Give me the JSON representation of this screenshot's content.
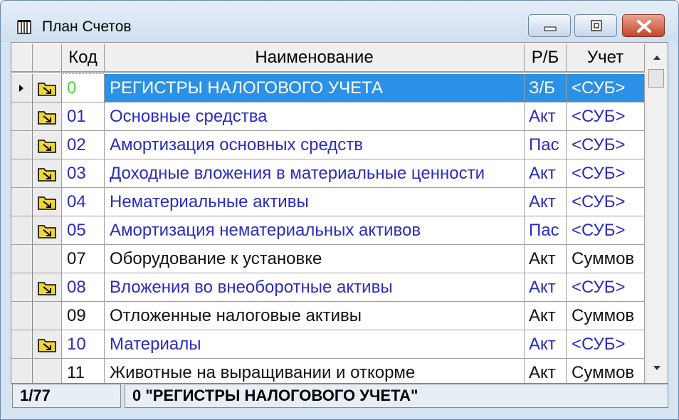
{
  "window": {
    "title": "План Счетов",
    "icon": "book-icon",
    "buttons": {
      "minimize": "minimize-icon",
      "maximize": "maximize-icon",
      "close": "close-icon"
    }
  },
  "grid": {
    "columns": [
      "Код",
      "Наименование",
      "Р/Б",
      "Учет"
    ],
    "rows": [
      {
        "folder": true,
        "code": "0",
        "name": "РЕГИСТРЫ НАЛОГОВОГО УЧЕТА",
        "rb": "З/Б",
        "uchet": "<СУБ>",
        "selected": true
      },
      {
        "folder": true,
        "code": "01",
        "name": "Основные средства",
        "rb": "Акт",
        "uchet": "<СУБ>"
      },
      {
        "folder": true,
        "code": "02",
        "name": "Амортизация основных средств",
        "rb": "Пас",
        "uchet": "<СУБ>"
      },
      {
        "folder": true,
        "code": "03",
        "name": "Доходные вложения в материальные ценности",
        "rb": "Акт",
        "uchet": "<СУБ>"
      },
      {
        "folder": true,
        "code": "04",
        "name": "Нематериальные активы",
        "rb": "Акт",
        "uchet": "<СУБ>"
      },
      {
        "folder": true,
        "code": "05",
        "name": "Амортизация нематериальных активов",
        "rb": "Пас",
        "uchet": "<СУБ>"
      },
      {
        "folder": false,
        "code": "07",
        "name": "Оборудование к установке",
        "rb": "Акт",
        "uchet": "Суммов"
      },
      {
        "folder": true,
        "code": "08",
        "name": "Вложения во внеоборотные активы",
        "rb": "Акт",
        "uchet": "<СУБ>"
      },
      {
        "folder": false,
        "code": "09",
        "name": "Отложенные налоговые активы",
        "rb": "Акт",
        "uchet": "Суммов"
      },
      {
        "folder": true,
        "code": "10",
        "name": "Материалы",
        "rb": "Акт",
        "uchet": "<СУБ>"
      },
      {
        "folder": false,
        "code": "11",
        "name": "Животные на выращивании и откорме",
        "rb": "Акт",
        "uchet": "Суммов"
      }
    ]
  },
  "status": {
    "position": "1/77",
    "current": "0 \"РЕГИСТРЫ НАЛОГОВОГО УЧЕТА\""
  },
  "colors": {
    "selection": "#2a91e6",
    "selected_code": "#4cd24c",
    "group_text": "#2a2cbf",
    "leaf_text": "#111111",
    "folder_fill": "#f2d633"
  }
}
